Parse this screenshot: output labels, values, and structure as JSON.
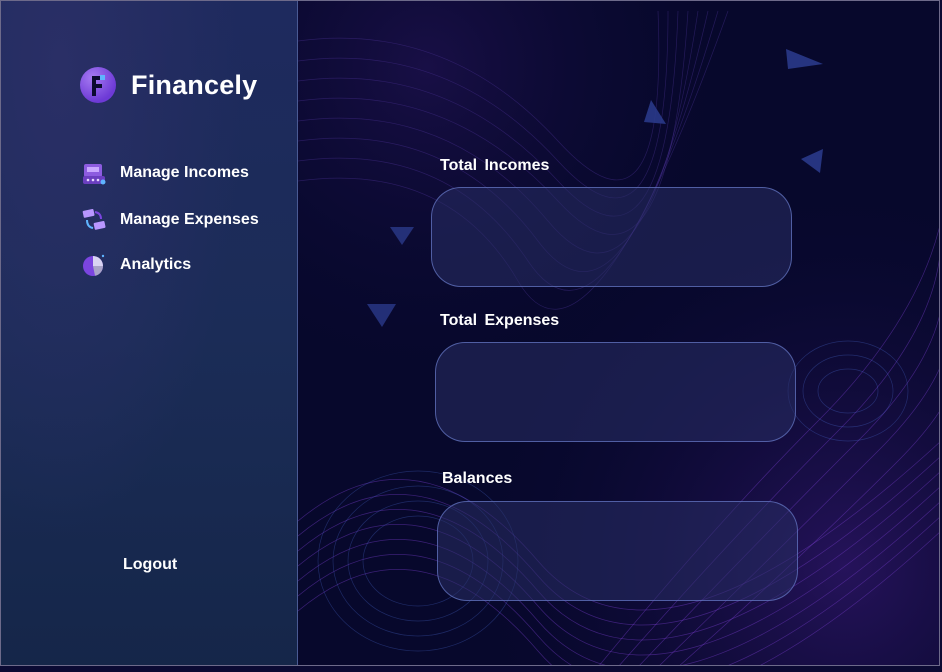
{
  "app": {
    "name": "Financely"
  },
  "sidebar": {
    "items": [
      {
        "label": "Manage Incomes",
        "icon": "cash-register-icon"
      },
      {
        "label": "Manage Expenses",
        "icon": "money-exchange-icon"
      },
      {
        "label": "Analytics",
        "icon": "pie-chart-icon"
      }
    ],
    "logout_label": "Logout"
  },
  "main": {
    "sections": [
      {
        "label": "Total  Incomes",
        "value": ""
      },
      {
        "label": "Total  Expenses",
        "value": ""
      },
      {
        "label": "Balances",
        "value": ""
      }
    ]
  },
  "colors": {
    "sidebar_bg": "#1b2c57",
    "main_bg": "#07082c",
    "accent_purple": "#7b45e0",
    "card_border": "#6e82d2"
  }
}
